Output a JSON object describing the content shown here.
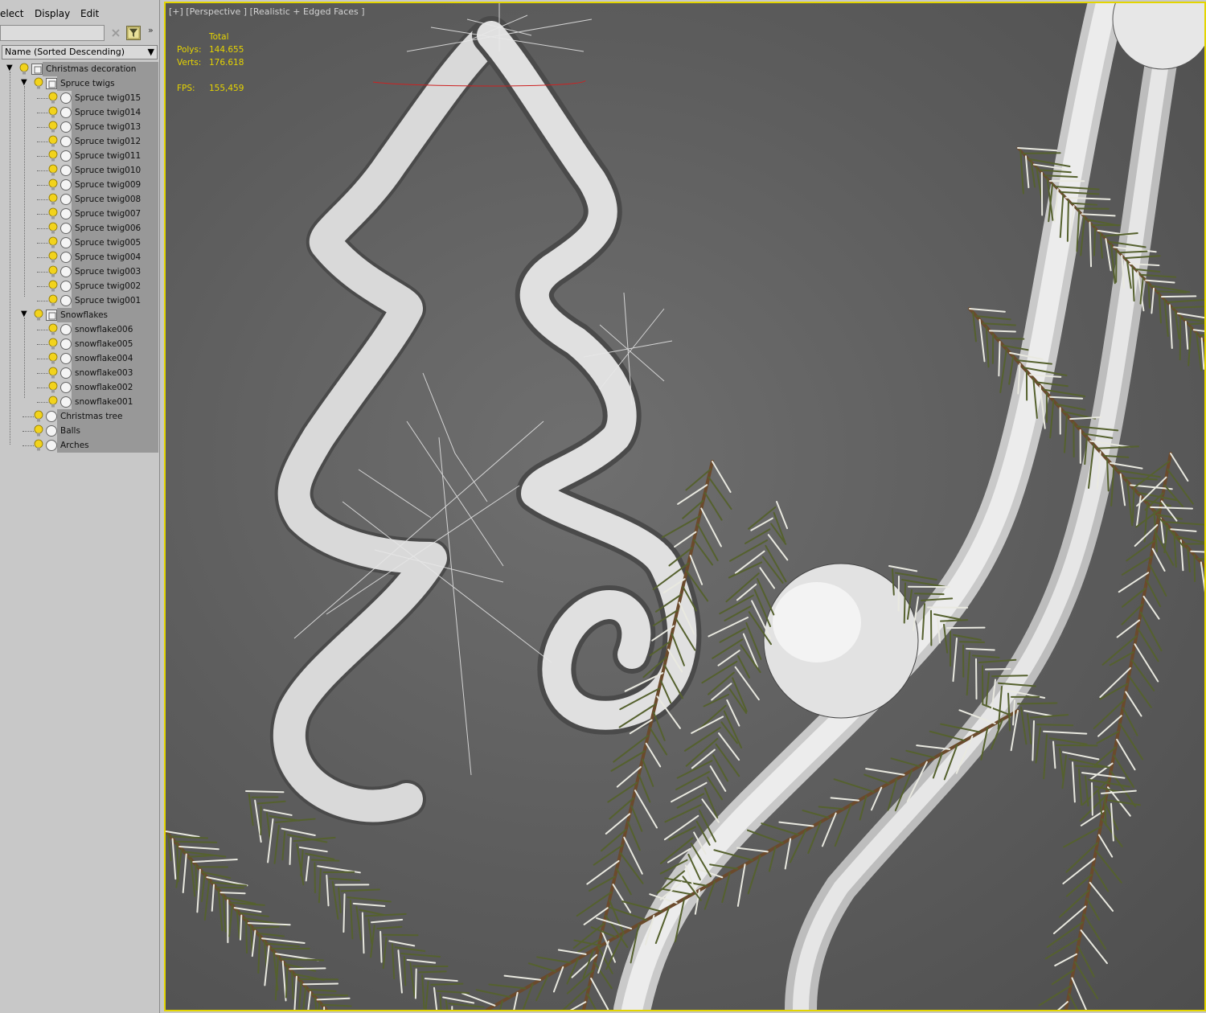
{
  "menu": {
    "select": "elect",
    "display": "Display",
    "edit": "Edit"
  },
  "search": {
    "value": ""
  },
  "sort": {
    "selected": "Name (Sorted Descending)"
  },
  "tree": [
    {
      "label": "Christmas decoration",
      "level": 0,
      "expanded": true,
      "icon": "group-icon",
      "selected": true
    },
    {
      "label": "Spruce twigs",
      "level": 1,
      "expanded": true,
      "icon": "group-icon",
      "selected": true
    },
    {
      "label": "Spruce twig015",
      "level": 2,
      "icon": "object-icon",
      "selected": true
    },
    {
      "label": "Spruce twig014",
      "level": 2,
      "icon": "object-icon",
      "selected": true
    },
    {
      "label": "Spruce twig013",
      "level": 2,
      "icon": "object-icon",
      "selected": true
    },
    {
      "label": "Spruce twig012",
      "level": 2,
      "icon": "object-icon",
      "selected": true
    },
    {
      "label": "Spruce twig011",
      "level": 2,
      "icon": "object-icon",
      "selected": true
    },
    {
      "label": "Spruce twig010",
      "level": 2,
      "icon": "object-icon",
      "selected": true
    },
    {
      "label": "Spruce twig009",
      "level": 2,
      "icon": "object-icon",
      "selected": true
    },
    {
      "label": "Spruce twig008",
      "level": 2,
      "icon": "object-icon",
      "selected": true
    },
    {
      "label": "Spruce twig007",
      "level": 2,
      "icon": "object-icon",
      "selected": true
    },
    {
      "label": "Spruce twig006",
      "level": 2,
      "icon": "object-icon",
      "selected": true
    },
    {
      "label": "Spruce twig005",
      "level": 2,
      "icon": "object-icon",
      "selected": true
    },
    {
      "label": "Spruce twig004",
      "level": 2,
      "icon": "object-icon",
      "selected": true
    },
    {
      "label": "Spruce twig003",
      "level": 2,
      "icon": "object-icon",
      "selected": true
    },
    {
      "label": "Spruce twig002",
      "level": 2,
      "icon": "object-icon",
      "selected": true
    },
    {
      "label": "Spruce twig001",
      "level": 2,
      "icon": "object-icon",
      "selected": true
    },
    {
      "label": "Snowflakes",
      "level": 1,
      "expanded": true,
      "icon": "group-icon",
      "selected": true
    },
    {
      "label": "snowflake006",
      "level": 2,
      "icon": "object-icon",
      "selected": true
    },
    {
      "label": "snowflake005",
      "level": 2,
      "icon": "object-icon",
      "selected": true
    },
    {
      "label": "snowflake004",
      "level": 2,
      "icon": "object-icon",
      "selected": true
    },
    {
      "label": "snowflake003",
      "level": 2,
      "icon": "object-icon",
      "selected": true
    },
    {
      "label": "snowflake002",
      "level": 2,
      "icon": "object-icon",
      "selected": true
    },
    {
      "label": "snowflake001",
      "level": 2,
      "icon": "object-icon",
      "selected": true
    },
    {
      "label": "Christmas tree",
      "level": 1,
      "icon": "object-icon",
      "selected": true
    },
    {
      "label": "Balls",
      "level": 1,
      "icon": "object-icon",
      "selected": true
    },
    {
      "label": "Arches",
      "level": 1,
      "icon": "object-icon",
      "selected": true
    }
  ],
  "viewport": {
    "label": "[+] [Perspective ] [Realistic + Edged Faces ]",
    "stats": {
      "total_label": "Total",
      "polys_label": "Polys:",
      "polys_value": "144.655",
      "verts_label": "Verts:",
      "verts_value": "176.618",
      "fps_label": "FPS:",
      "fps_value": "155,459"
    }
  },
  "colors": {
    "viewport_border": "#e3d500",
    "stats_text": "#e6d400",
    "selection_highlight": "#989898"
  }
}
